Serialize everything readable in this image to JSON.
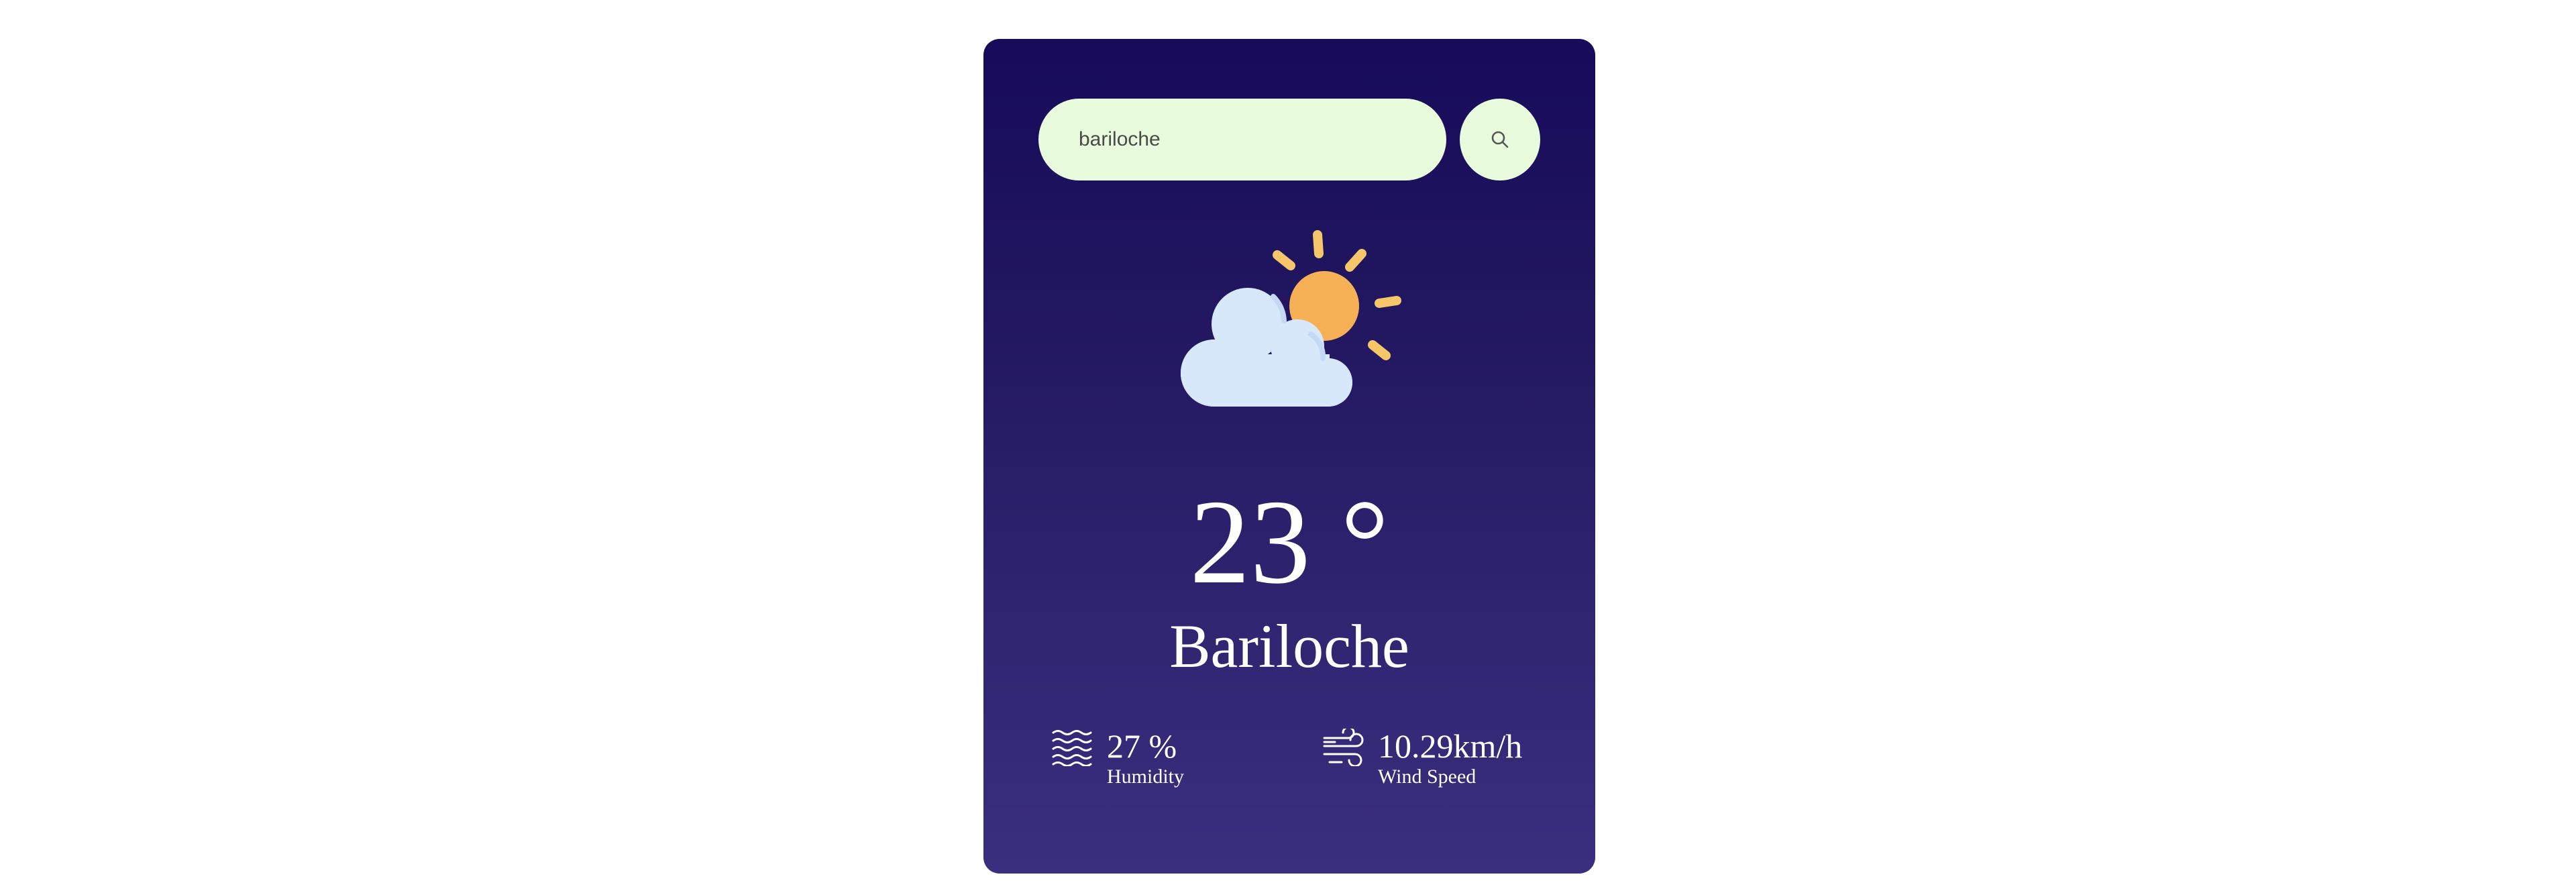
{
  "search": {
    "value": "bariloche",
    "placeholder": ""
  },
  "icons": {
    "search_button": "search-icon",
    "weather": "partly-cloudy-icon",
    "humidity": "waves-icon",
    "wind": "wind-icon"
  },
  "weather": {
    "temperature": "23 °",
    "city": "Bariloche"
  },
  "stats": {
    "humidity": {
      "value": "27 %",
      "label": "Humidity"
    },
    "wind": {
      "value": "10.29km/h",
      "label": "Wind Speed"
    }
  },
  "colors": {
    "card_top": "#170b5a",
    "card_bottom": "#3a2f7e",
    "input_bg": "#e8fbdc",
    "sun": "#f6b157",
    "sun_rays": "#f6c66a",
    "cloud": "#d8e8fb",
    "text": "#ffffff"
  }
}
